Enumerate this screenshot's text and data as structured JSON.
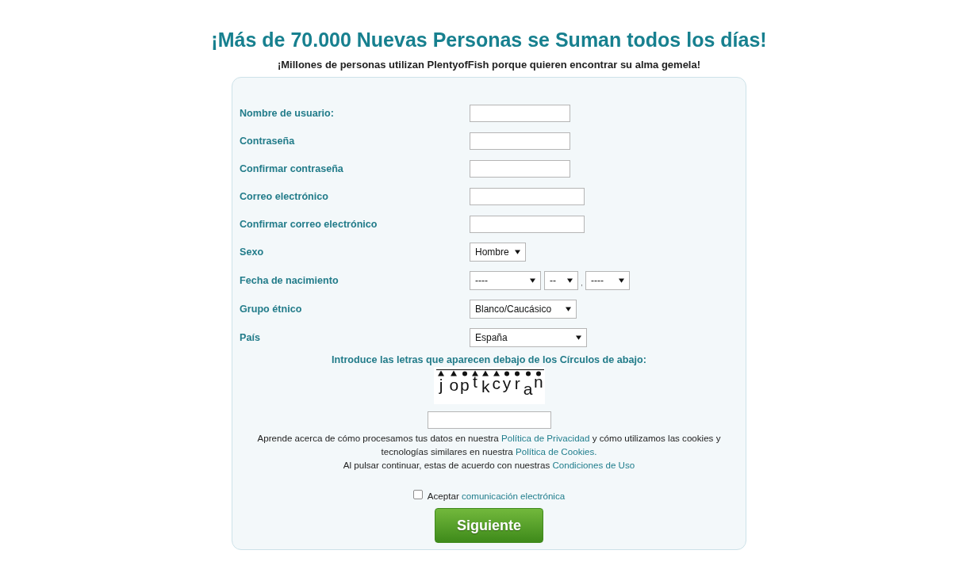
{
  "headline": "¡Más de 70.000 Nuevas Personas se Suman todos los días!",
  "subheadline": "¡Millones de personas utilizan PlentyofFish porque quieren encontrar su alma gemela!",
  "form": {
    "fields": [
      {
        "label": "Nombre de usuario:",
        "kind": "text"
      },
      {
        "label": "Contraseña",
        "kind": "text"
      },
      {
        "label": "Confirmar contraseña",
        "kind": "text"
      },
      {
        "label": "Correo electrónico",
        "kind": "email"
      },
      {
        "label": "Confirmar correo electrónico",
        "kind": "email"
      },
      {
        "label": "Sexo",
        "kind": "select",
        "value": "Hombre"
      },
      {
        "label": "Fecha de nacimiento",
        "kind": "date",
        "parts": [
          {
            "value": "----"
          },
          {
            "value": "--"
          },
          {
            "value": "----"
          }
        ],
        "separator": ","
      },
      {
        "label": "Grupo étnico",
        "kind": "select",
        "value": "Blanco/Caucásico"
      },
      {
        "label": "País",
        "kind": "select",
        "value": "España"
      }
    ],
    "captcha": {
      "prompt": "Introduce las letras que aparecen debajo de los Círculos de abajo:",
      "letters": [
        {
          "char": "j",
          "kind": "triangle"
        },
        {
          "char": "o",
          "kind": "triangle"
        },
        {
          "char": "p",
          "kind": "circle"
        },
        {
          "char": "t",
          "kind": "triangle"
        },
        {
          "char": "k",
          "kind": "triangle"
        },
        {
          "char": "c",
          "kind": "triangle"
        },
        {
          "char": "y",
          "kind": "circle"
        },
        {
          "char": "r",
          "kind": "circle"
        },
        {
          "char": "a",
          "kind": "circle"
        },
        {
          "char": "n",
          "kind": "circle"
        }
      ]
    },
    "notices": [
      [
        {
          "kind": "text",
          "text": "Aprende acerca de cómo procesamos tus datos en nuestra "
        },
        {
          "kind": "link",
          "text": "Política de Privacidad"
        },
        {
          "kind": "text",
          "text": " y cómo utilizamos las cookies y tecnologías similares en nuestra "
        },
        {
          "kind": "link",
          "text": "Política de Cookies."
        }
      ],
      [
        {
          "kind": "text",
          "text": "Al pulsar continuar, estas de acuerdo con nuestras "
        },
        {
          "kind": "link",
          "text": "Condiciones de Uso"
        }
      ]
    ],
    "consent": {
      "checked": false,
      "parts": [
        {
          "kind": "text",
          "text": "Aceptar "
        },
        {
          "kind": "link",
          "text": "comunicación electrónica"
        }
      ]
    },
    "submit": "Siguiente"
  }
}
